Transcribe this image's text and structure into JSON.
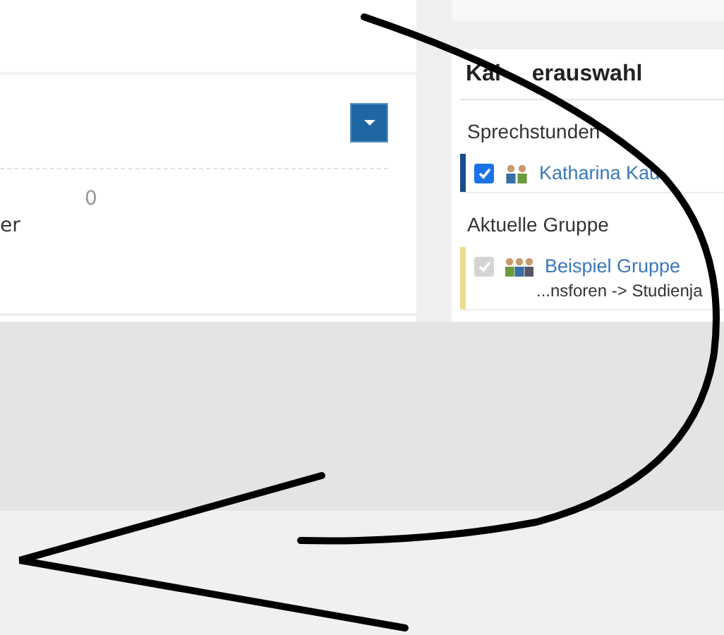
{
  "main_panel": {
    "count": "0",
    "label": "er"
  },
  "sidebar": {
    "title_parts": [
      "Kal",
      "erauswahl"
    ],
    "sections": [
      {
        "heading": "Sprechstunden",
        "calendars": [
          {
            "kind": "person",
            "name": "Katharina Kau",
            "checked": true,
            "disabled": false,
            "color": "#1a4b8c"
          }
        ]
      },
      {
        "heading": "Aktuelle Gruppe",
        "calendars": [
          {
            "kind": "group",
            "name": "Beispiel Gruppe",
            "subtitle": "...nsforen -> Studienja",
            "checked": true,
            "disabled": true,
            "color": "#f0dc8c"
          }
        ]
      }
    ]
  }
}
